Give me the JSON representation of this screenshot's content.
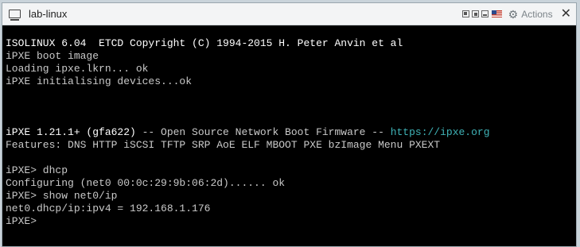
{
  "window": {
    "title": "lab-linux",
    "actions_label": "Actions",
    "close_glyph": "✕"
  },
  "console": {
    "lines": [
      {
        "segments": [
          {
            "text": "ISOLINUX 6.04  ETCD Copyright (C) 1994-2015 H. Peter Anvin et al",
            "style": "bright"
          }
        ]
      },
      {
        "segments": [
          {
            "text": "iPXE boot image",
            "style": "normal"
          }
        ]
      },
      {
        "segments": [
          {
            "text": "Loading ipxe.lkrn... ok",
            "style": "normal"
          }
        ]
      },
      {
        "segments": [
          {
            "text": "iPXE initialising devices...ok",
            "style": "normal"
          }
        ]
      },
      {
        "segments": []
      },
      {
        "segments": []
      },
      {
        "segments": []
      },
      {
        "segments": [
          {
            "text": "iPXE 1.21.1+ (gfa622)",
            "style": "bright"
          },
          {
            "text": " -- Open Source Network Boot Firmware -- ",
            "style": "normal"
          },
          {
            "text": "https://ipxe.org",
            "style": "url"
          }
        ]
      },
      {
        "segments": [
          {
            "text": "Features: DNS HTTP iSCSI TFTP SRP AoE ELF MBOOT PXE bzImage Menu PXEXT",
            "style": "normal"
          }
        ]
      },
      {
        "segments": []
      },
      {
        "segments": [
          {
            "text": "iPXE> dhcp",
            "style": "normal"
          }
        ]
      },
      {
        "segments": [
          {
            "text": "Configuring (net0 00:0c:29:9b:06:2d)...... ok",
            "style": "normal"
          }
        ]
      },
      {
        "segments": [
          {
            "text": "iPXE> show net0/ip",
            "style": "normal"
          }
        ]
      },
      {
        "segments": [
          {
            "text": "net0.dhcp/ip:ipv4 = 192.168.1.176",
            "style": "normal"
          }
        ]
      },
      {
        "segments": [
          {
            "text": "iPXE>",
            "style": "normal"
          }
        ]
      }
    ]
  },
  "icons": {
    "app": "console-window-icon",
    "view1": "fit-window-icon",
    "view2": "resize-icon",
    "view3": "fullscreen-icon",
    "keyboard_flag": "us-flag-icon",
    "gear": "gear-icon",
    "close": "close-icon"
  },
  "colors": {
    "console_bg": "#000000",
    "text": "#c9c9c9",
    "bright_text": "#ffffff",
    "url": "#3fb3b7"
  }
}
